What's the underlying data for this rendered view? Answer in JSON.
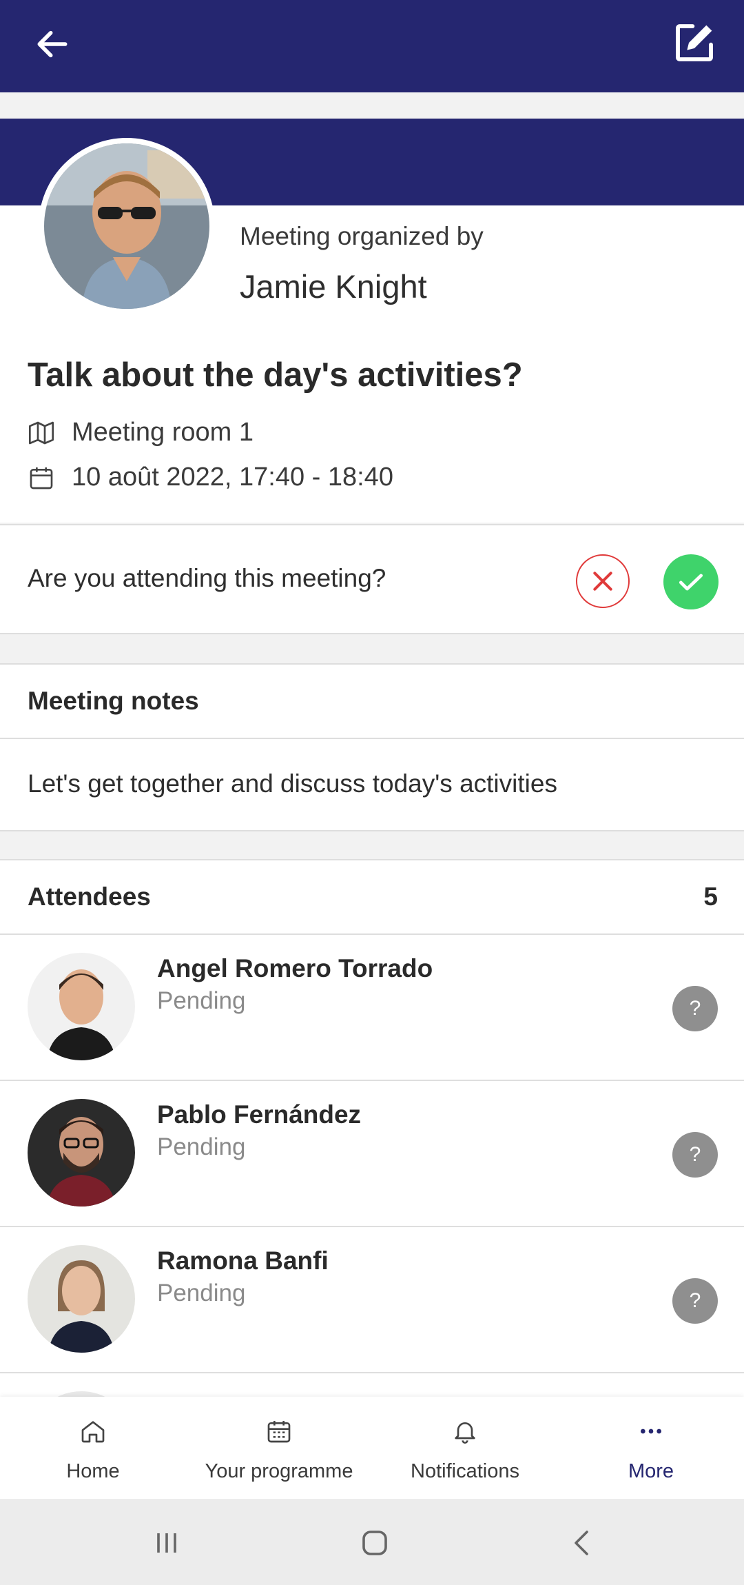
{
  "header": {
    "back_icon": "arrow-left-icon",
    "edit_icon": "edit-icon",
    "color": "#252670"
  },
  "organizer": {
    "subtitle": "Meeting organized by",
    "name": "Jamie Knight"
  },
  "meeting": {
    "title": "Talk about the day's activities?",
    "location": "Meeting room 1",
    "datetime": "10 août 2022, 17:40 - 18:40",
    "location_icon": "map-icon",
    "date_icon": "calendar-icon"
  },
  "attendance": {
    "question": "Are you attending this meeting?",
    "decline_icon": "close-icon",
    "accept_icon": "check-icon",
    "decline_color": "#e03a3a",
    "accept_color": "#3fd36b"
  },
  "notes": {
    "heading": "Meeting notes",
    "text": "Let's get together and discuss today's activities"
  },
  "attendees": {
    "heading": "Attendees",
    "count": "5",
    "items": [
      {
        "name": "Angel Romero Torrado",
        "status": "Pending",
        "badge": "?"
      },
      {
        "name": "Pablo Fernández",
        "status": "Pending",
        "badge": "?"
      },
      {
        "name": "Ramona Banfi",
        "status": "Pending",
        "badge": "?"
      }
    ]
  },
  "bottom_nav": {
    "items": [
      {
        "label": "Home",
        "icon": "home-icon"
      },
      {
        "label": "Your programme",
        "icon": "calendar-icon"
      },
      {
        "label": "Notifications",
        "icon": "bell-icon"
      },
      {
        "label": "More",
        "icon": "more-icon"
      }
    ],
    "active": "More"
  },
  "system_bar": {
    "icons": [
      "recent-apps-icon",
      "home-button-icon",
      "back-icon"
    ]
  }
}
